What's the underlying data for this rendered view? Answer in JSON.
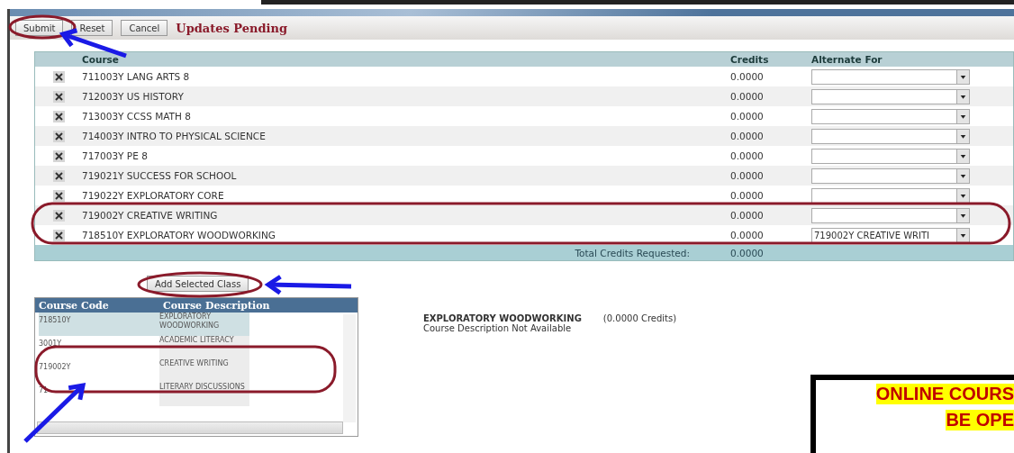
{
  "toolbar": {
    "buttons": [
      "Submit",
      "Reset",
      "Cancel"
    ],
    "status": "Updates Pending"
  },
  "requests": {
    "columns": [
      "Course",
      "Credits",
      "Alternate For"
    ],
    "rows": [
      {
        "course": "711003Y LANG ARTS 8",
        "credits": "0.0000",
        "alternate": ""
      },
      {
        "course": "712003Y US HISTORY",
        "credits": "0.0000",
        "alternate": ""
      },
      {
        "course": "713003Y CCSS MATH 8",
        "credits": "0.0000",
        "alternate": ""
      },
      {
        "course": "714003Y INTRO TO PHYSICAL SCIENCE",
        "credits": "0.0000",
        "alternate": ""
      },
      {
        "course": "717003Y PE 8",
        "credits": "0.0000",
        "alternate": ""
      },
      {
        "course": "719021Y SUCCESS FOR SCHOOL",
        "credits": "0.0000",
        "alternate": ""
      },
      {
        "course": "719022Y EXPLORATORY CORE",
        "credits": "0.0000",
        "alternate": ""
      },
      {
        "course": "719002Y CREATIVE WRITING",
        "credits": "0.0000",
        "alternate": ""
      },
      {
        "course": "718510Y EXPLORATORY WOODWORKING",
        "credits": "0.0000",
        "alternate": "719002Y CREATIVE WRITI"
      }
    ],
    "total_label": "Total Credits Requested:",
    "total": "0.0000"
  },
  "add_button": "Add Selected Class",
  "catalog": {
    "columns": [
      "Course Code",
      "Course Description"
    ],
    "rows": [
      {
        "code": "718510Y",
        "description": "EXPLORATORY WOODWORKING",
        "selected": true
      },
      {
        "code": "3001Y",
        "description": "ACADEMIC LITERACY",
        "selected": false
      },
      {
        "code": "719002Y",
        "description": "CREATIVE WRITING",
        "selected": false
      },
      {
        "code": "71",
        "description": "LITERARY DISCUSSIONS",
        "selected": false
      }
    ]
  },
  "detail": {
    "title": "EXPLORATORY WOODWORKING",
    "credits": "(0.0000 Credits)",
    "description": "Course Description Not Available"
  },
  "notice": {
    "lines": [
      "ONLINE COURS",
      "BE OPE"
    ]
  }
}
